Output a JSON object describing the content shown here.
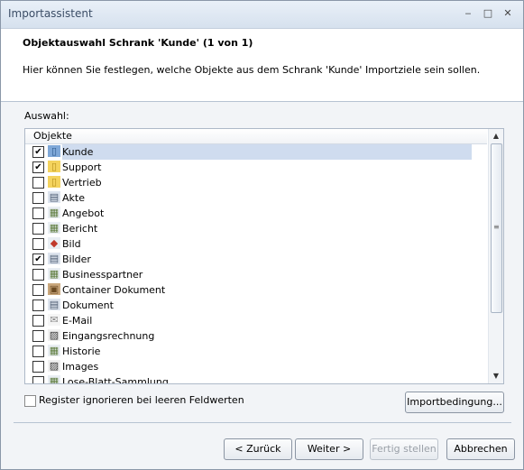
{
  "window": {
    "title": "Importassistent",
    "minimize_glyph": "‒",
    "maximize_glyph": "□",
    "close_glyph": "✕"
  },
  "header": {
    "title": "Objektauswahl Schrank 'Kunde' (1 von 1)",
    "description": "Hier können Sie festlegen, welche Objekte aus dem Schrank 'Kunde' Importziele sein sollen."
  },
  "selection": {
    "label": "Auswahl:",
    "column_header": "Objekte",
    "items": [
      {
        "label": "Kunde",
        "checked": true,
        "selected": true,
        "icon": "folder-blue-icon"
      },
      {
        "label": "Support",
        "checked": true,
        "selected": false,
        "icon": "folder-yellow-icon"
      },
      {
        "label": "Vertrieb",
        "checked": false,
        "selected": false,
        "icon": "folder-yellow-icon"
      },
      {
        "label": "Akte",
        "checked": false,
        "selected": false,
        "icon": "file-card-icon"
      },
      {
        "label": "Angebot",
        "checked": false,
        "selected": false,
        "icon": "image-doc-icon"
      },
      {
        "label": "Bericht",
        "checked": false,
        "selected": false,
        "icon": "image-doc-icon"
      },
      {
        "label": "Bild",
        "checked": false,
        "selected": false,
        "icon": "picture-icon"
      },
      {
        "label": "Bilder",
        "checked": true,
        "selected": false,
        "icon": "file-card-icon"
      },
      {
        "label": "Businesspartner",
        "checked": false,
        "selected": false,
        "icon": "image-doc-icon"
      },
      {
        "label": "Container Dokument",
        "checked": false,
        "selected": false,
        "icon": "container-icon"
      },
      {
        "label": "Dokument",
        "checked": false,
        "selected": false,
        "icon": "file-card-icon"
      },
      {
        "label": "E-Mail",
        "checked": false,
        "selected": false,
        "icon": "envelope-icon"
      },
      {
        "label": "Eingangsrechnung",
        "checked": false,
        "selected": false,
        "icon": "scan-icon"
      },
      {
        "label": "Historie",
        "checked": false,
        "selected": false,
        "icon": "image-doc-icon"
      },
      {
        "label": "Images",
        "checked": false,
        "selected": false,
        "icon": "scan-icon"
      },
      {
        "label": "Lose-Blatt-Sammlung",
        "checked": false,
        "selected": false,
        "icon": "image-doc-icon"
      }
    ]
  },
  "options": {
    "ignore_register_label": "Register ignorieren bei leeren Feldwerten",
    "ignore_register_checked": false,
    "import_conditions_button": "Importbedingung..."
  },
  "footer": {
    "back_button": "< Zurück",
    "next_button": "Weiter >",
    "finish_button": "Fertig stellen",
    "cancel_button": "Abbrechen"
  }
}
